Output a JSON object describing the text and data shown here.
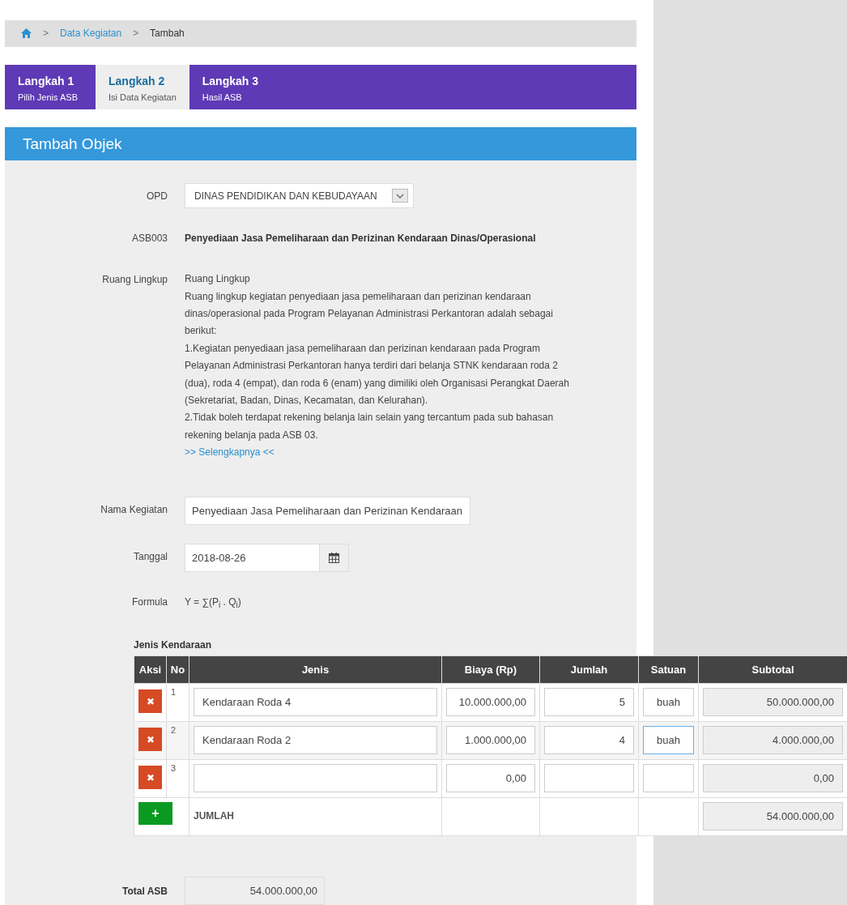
{
  "breadcrumb": {
    "items": [
      {
        "label": "Data Kegiatan",
        "kind": "link"
      },
      {
        "label": "Tambah",
        "kind": "current"
      }
    ],
    "separators": [
      ">",
      ">"
    ]
  },
  "steps": [
    {
      "title": "Langkah 1",
      "subtitle": "Pilih Jenis ASB",
      "selected": false
    },
    {
      "title": "Langkah 2",
      "subtitle": "Isi Data Kegiatan",
      "selected": true
    },
    {
      "title": "Langkah 3",
      "subtitle": "Hasil ASB",
      "selected": false
    }
  ],
  "panel": {
    "title": "Tambah Objek"
  },
  "form": {
    "opd": {
      "label": "OPD",
      "value": "DINAS PENDIDIKAN DAN KEBUDAYAAN"
    },
    "asb": {
      "code": "ASB003",
      "name": "Penyediaan Jasa Pemeliharaan dan Perizinan Kendaraan Dinas/Operasional"
    },
    "ruang_lingkup": {
      "label": "Ruang Lingkup",
      "heading": "Ruang Lingkup",
      "lines": [
        "Ruang lingkup kegiatan penyediaan jasa pemeliharaan dan perizinan kendaraan dinas/operasional pada Program Pelayanan Administrasi Perkantoran adalah sebagai berikut:",
        "1.Kegiatan penyediaan jasa pemeliharaan dan perizinan kendaraan pada Program Pelayanan Administrasi Perkantoran hanya terdiri dari belanja STNK kendaraan roda 2 (dua), roda 4 (empat), dan roda 6 (enam) yang dimiliki oleh Organisasi Perangkat Daerah (Sekretariat, Badan, Dinas, Kecamatan, dan Kelurahan).",
        "2.Tidak boleh terdapat rekening belanja lain selain yang tercantum pada sub bahasan rekening belanja pada ASB 03."
      ],
      "more_link": ">> Selengkapnya <<"
    },
    "nama_kegiatan": {
      "label": "Nama Kegiatan",
      "value": "Penyediaan Jasa Pemeliharaan dan Perizinan Kendaraan"
    },
    "tanggal": {
      "label": "Tanggal",
      "value": "2018-08-26"
    },
    "formula": {
      "label": "Formula",
      "value": "Y = ∑(P$_{i}$ . Q$_{i}$)"
    }
  },
  "table": {
    "title": "Jenis Kendaraan",
    "columns": [
      "Aksi",
      "No",
      "Jenis",
      "Biaya (Rp)",
      "Jumlah",
      "Satuan",
      "Subtotal"
    ],
    "rows": [
      {
        "delete_icon": "✖",
        "no": "1",
        "jenis": "Kendaraan Roda 4",
        "biaya": "10.000.000,00",
        "jumlah": "5",
        "satuan": "buah",
        "satuan_focused": false,
        "subtotal": "50.000.000,00"
      },
      {
        "delete_icon": "✖",
        "no": "2",
        "jenis": "Kendaraan Roda 2",
        "biaya": "1.000.000,00",
        "jumlah": "4",
        "satuan": "buah",
        "satuan_focused": true,
        "subtotal": "4.000.000,00"
      },
      {
        "delete_icon": "✖",
        "no": "3",
        "biaya": "0,00",
        "satuan_focused": false,
        "subtotal": "0,00"
      }
    ],
    "footer": {
      "add_icon": "+",
      "label": "JUMLAH",
      "total": "54.000.000,00"
    }
  },
  "total_asb": {
    "label": "Total ASB",
    "value": "54.000.000,00"
  }
}
